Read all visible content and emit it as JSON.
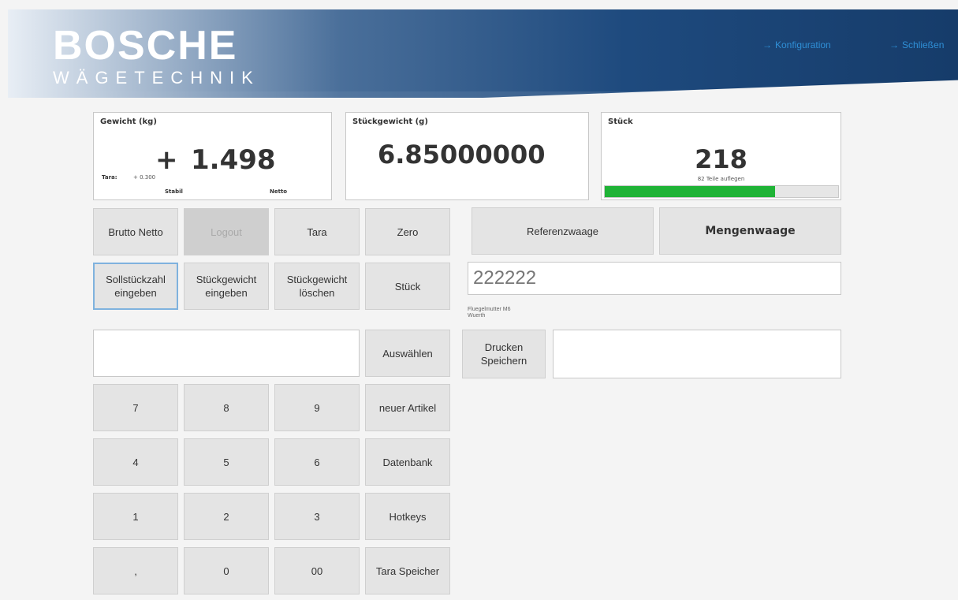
{
  "header": {
    "logo_main": "BOSCHE",
    "logo_sub": "WÄGETECHNIK",
    "nav": [
      {
        "label": "Konfiguration"
      },
      {
        "label": "Schließen"
      }
    ]
  },
  "weight_panel": {
    "title": "Gewicht (kg)",
    "sign": "+",
    "value": "1.498",
    "tare_label": "Tara:",
    "tare_value": "+ 0.300",
    "stable_label": "Stabil",
    "mode_label": "Netto"
  },
  "piece_weight_panel": {
    "title": "Stückgewicht (g)",
    "value": "6.85000000"
  },
  "count_panel": {
    "title": "Stück",
    "value": "218",
    "hint": "82 Teile auflegen",
    "progress_percent": 73,
    "progress_color": "#1fb336"
  },
  "buttons": {
    "brutto_netto": "Brutto Netto",
    "logout": "Logout",
    "tara": "Tara",
    "zero": "Zero",
    "referenzwaage": "Referenzwaage",
    "mengenwaage": "Mengenwaage",
    "sollstueckzahl": "Sollstückzahl eingeben",
    "stueckgewicht_eingeben": "Stückgewicht eingeben",
    "stueckgewicht_loeschen": "Stückgewicht löschen",
    "stueck": "Stück",
    "auswaehlen": "Auswählen",
    "drucken_speichern": "Drucken Speichern",
    "neuer_artikel": "neuer Artikel",
    "datenbank": "Datenbank",
    "hotkeys": "Hotkeys",
    "tara_speicher": "Tara Speicher"
  },
  "keypad": [
    "7",
    "8",
    "9",
    "4",
    "5",
    "6",
    "1",
    "2",
    "3",
    ",",
    "0",
    "00"
  ],
  "reference": {
    "value": "222222",
    "article_name": "Fluegelmutter M6",
    "article_vendor": "Wuerth"
  },
  "selection_input": {
    "value": ""
  },
  "print_field": {
    "value": ""
  },
  "colors": {
    "accent": "#1e4a7e",
    "link": "#2f8fd6",
    "progress": "#1fb336",
    "selected_border": "#7fb2de"
  }
}
